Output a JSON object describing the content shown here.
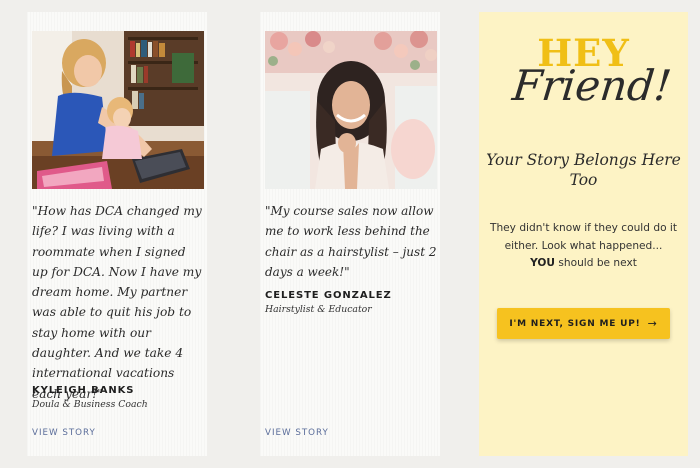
{
  "testimonials": [
    {
      "quote": "\"How has DCA changed my life? I was living with a roommate when I signed up for DCA. Now I have my dream home. My partner was able to quit his job to stay home with our daughter. And we take 4 international vacations each year!\"",
      "name": "KYLEIGH BANKS",
      "role": "Doula & Business Coach",
      "link_label": "VIEW STORY"
    },
    {
      "quote": "\"My course sales now allow me to work less behind the chair as a hairstylist – just 2 days a week!\"",
      "name": "CELESTE GONZALEZ",
      "role": "Hairstylist & Educator",
      "link_label": "VIEW STORY"
    }
  ],
  "cta": {
    "hey": "HEY",
    "friend": "Friend!",
    "headline": "Your Story Belongs Here Too",
    "desc_line": "They didn't know if they could do it either. Look what happened...",
    "desc_bold": "YOU",
    "desc_tail": " should be next",
    "button_label": "I'M NEXT, SIGN ME UP!",
    "button_arrow": "→"
  },
  "colors": {
    "page_bg": "#f0efec",
    "cta_bg": "#fdf3c5",
    "accent_yellow": "#f6c21f",
    "link_blue": "#5b6d9a"
  }
}
